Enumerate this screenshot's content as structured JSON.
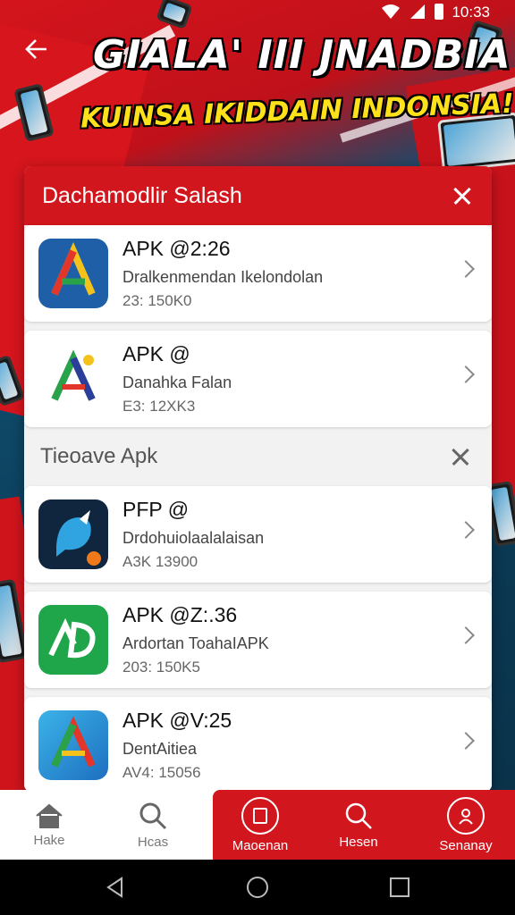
{
  "status": {
    "time": "10:33"
  },
  "hero": {
    "title": "GIALA' III JNADBIA",
    "subtitle": "KUINSA IKIDDAIN INDONSIA!"
  },
  "panel": {
    "title": "Dachamodlir Salash",
    "apps_top": [
      {
        "name": "APK @2:26",
        "desc": "Dralkenmendan Ikelondolan",
        "meta": "23: 150K0"
      },
      {
        "name": "APK @",
        "desc": "Danahka Falan",
        "meta": "E3: 12XK3"
      }
    ],
    "section_title": "Tieoave Apk",
    "apps_bottom": [
      {
        "name": "PFP @",
        "desc": "Drdohuiolaalalaisan",
        "meta": "A3K 13900"
      },
      {
        "name": "APK @Z:.36",
        "desc": "Ardortan ToahaIAPK",
        "meta": "203: 150K5"
      },
      {
        "name": "APK @V:25",
        "desc": "DentAitiea",
        "meta": "AV4: 15056"
      }
    ]
  },
  "bottom_nav": [
    {
      "label": "Hake",
      "icon": "home-icon"
    },
    {
      "label": "Hcas",
      "icon": "search-icon"
    },
    {
      "label": "Maoenan",
      "icon": "tablet-icon"
    },
    {
      "label": "Hesen",
      "icon": "search-icon"
    },
    {
      "label": "Senanay",
      "icon": "profile-icon"
    }
  ],
  "colors": {
    "brand_red": "#d1161d",
    "hero_yellow": "#ffe11a",
    "hero_blue": "#0f4d6e"
  }
}
